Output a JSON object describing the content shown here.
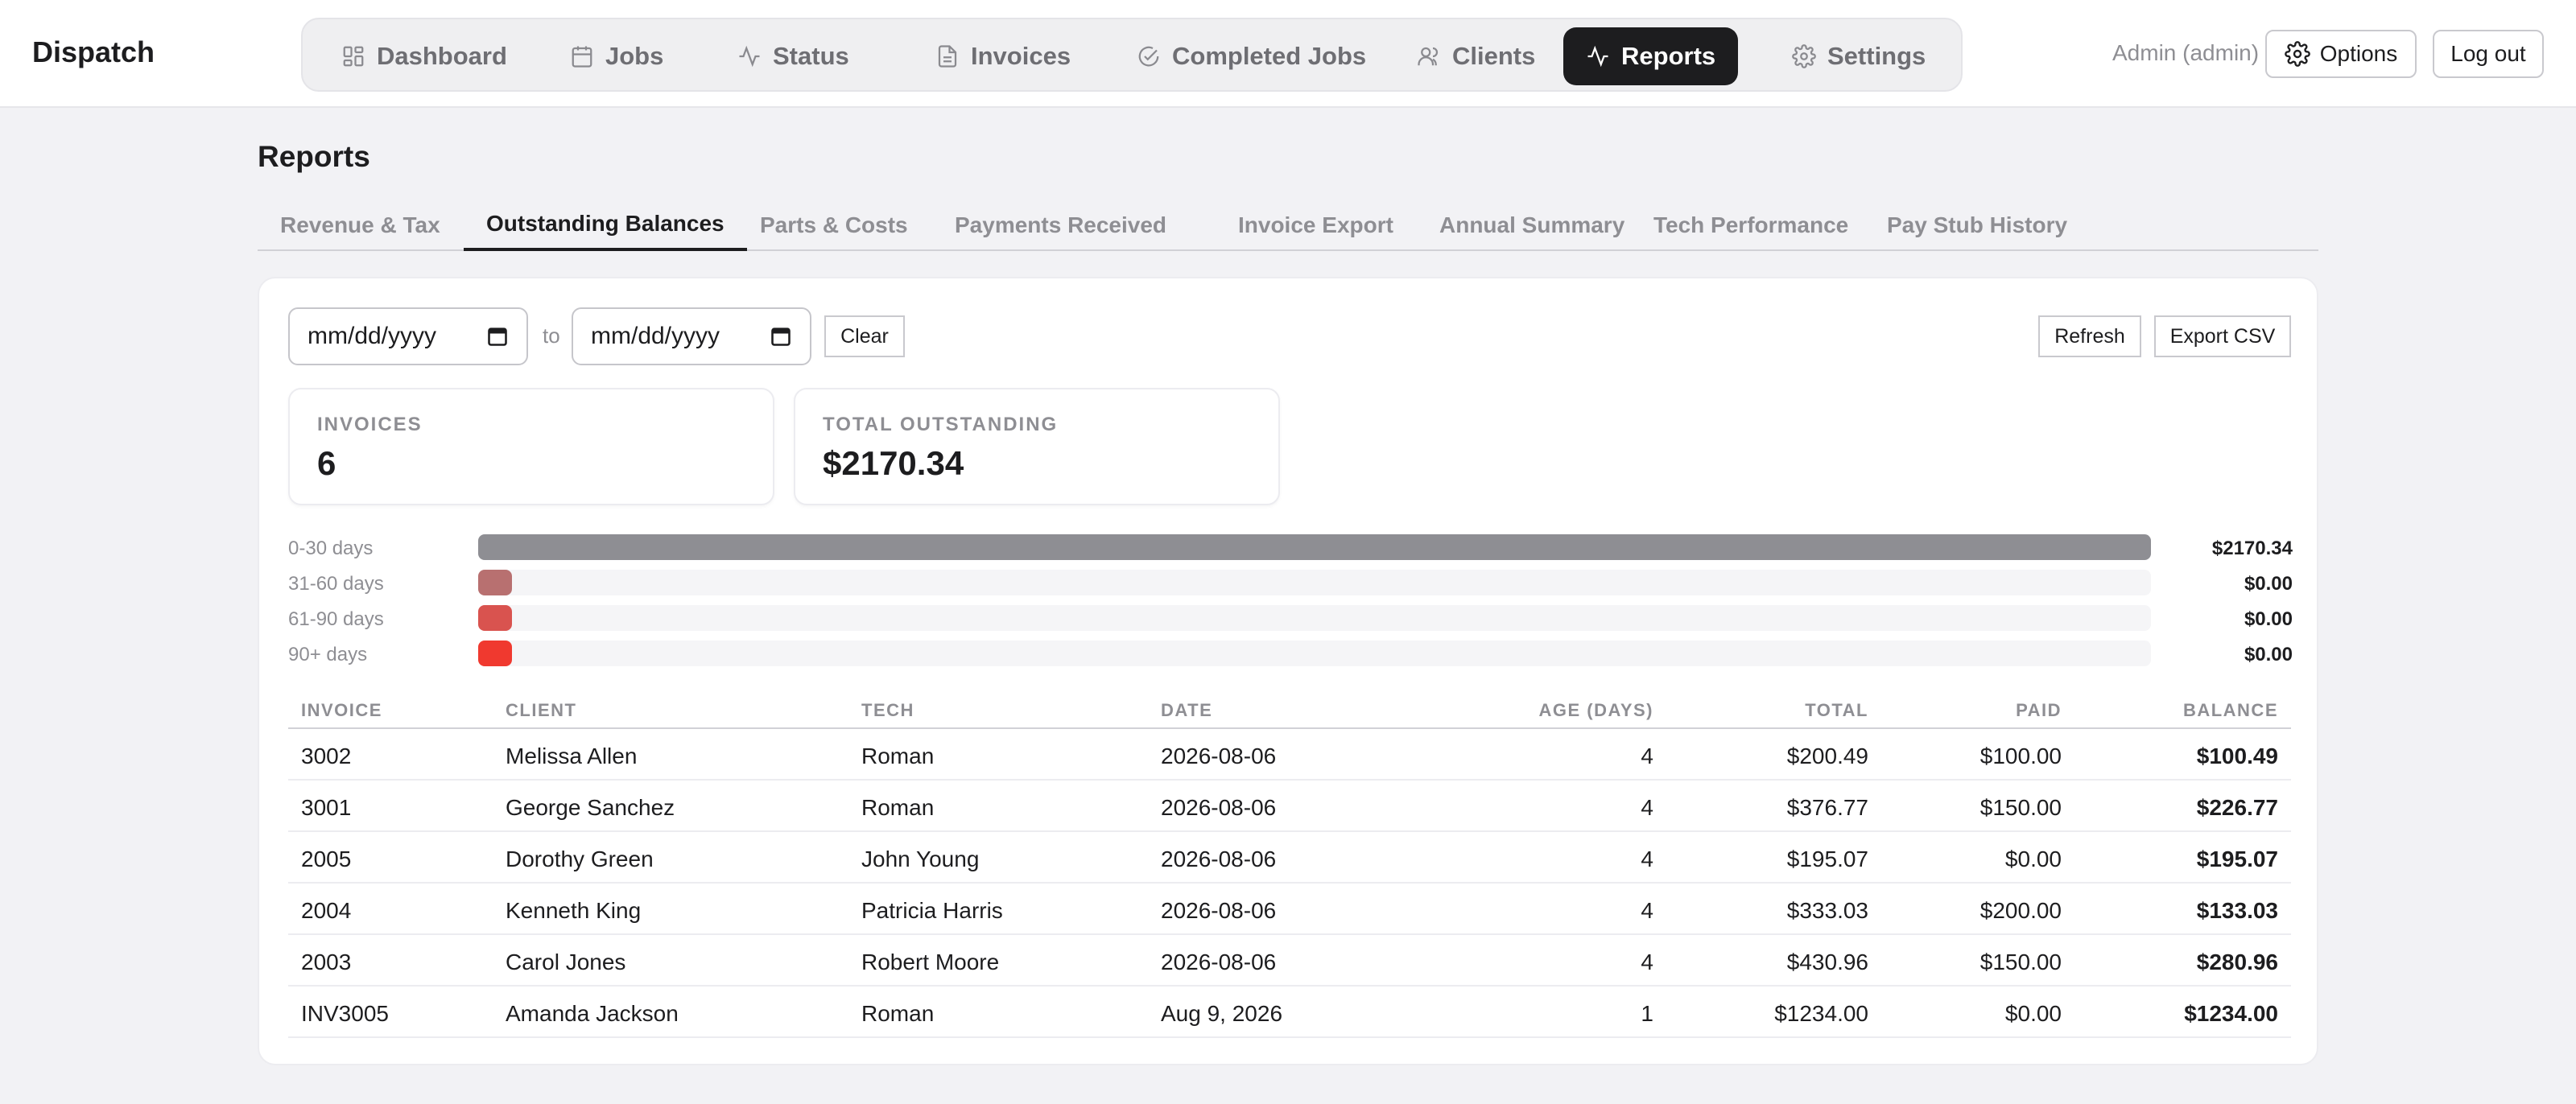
{
  "app": {
    "brand": "Dispatch"
  },
  "nav": {
    "items": [
      {
        "label": "Dashboard",
        "icon": "dashboard-icon"
      },
      {
        "label": "Jobs",
        "icon": "calendar-icon"
      },
      {
        "label": "Status",
        "icon": "activity-icon"
      },
      {
        "label": "Invoices",
        "icon": "document-icon"
      },
      {
        "label": "Completed Jobs",
        "icon": "check-circle-icon"
      },
      {
        "label": "Clients",
        "icon": "users-icon"
      },
      {
        "label": "Reports",
        "icon": "activity-icon"
      },
      {
        "label": "Settings",
        "icon": "gear-icon"
      }
    ],
    "active": "Reports"
  },
  "header": {
    "admin_label": "Admin (admin)",
    "options_label": "Options",
    "logout_label": "Log out"
  },
  "page": {
    "title": "Reports",
    "tabs": [
      "Revenue & Tax",
      "Outstanding Balances",
      "Parts & Costs",
      "Payments Received",
      "Invoice Export",
      "Annual Summary",
      "Tech Performance",
      "Pay Stub History"
    ],
    "active_tab": "Outstanding Balances"
  },
  "filters": {
    "from_placeholder": "mm/dd/yyyy",
    "to_label": "to",
    "to_placeholder": "mm/dd/yyyy",
    "clear_label": "Clear",
    "refresh_label": "Refresh",
    "export_label": "Export CSV"
  },
  "stats": {
    "invoices_label": "INVOICES",
    "invoices_value": "6",
    "outstanding_label": "TOTAL OUTSTANDING",
    "outstanding_value": "$2170.34"
  },
  "aging": [
    {
      "label": "0-30 days",
      "amount": "$2170.34",
      "fraction": 1.0,
      "color": "#8e8e93"
    },
    {
      "label": "31-60 days",
      "amount": "$0.00",
      "fraction": 0.0,
      "color": "#b87070"
    },
    {
      "label": "61-90 days",
      "amount": "$0.00",
      "fraction": 0.0,
      "color": "#d9534f"
    },
    {
      "label": "90+ days",
      "amount": "$0.00",
      "fraction": 0.0,
      "color": "#f0392f"
    }
  ],
  "table": {
    "columns": [
      "INVOICE",
      "CLIENT",
      "TECH",
      "DATE",
      "AGE (DAYS)",
      "TOTAL",
      "PAID",
      "BALANCE"
    ],
    "rows": [
      {
        "invoice": "3002",
        "client": "Melissa Allen",
        "tech": "Roman",
        "date": "2026-08-06",
        "age": "4",
        "total": "$200.49",
        "paid": "$100.00",
        "balance": "$100.49"
      },
      {
        "invoice": "3001",
        "client": "George Sanchez",
        "tech": "Roman",
        "date": "2026-08-06",
        "age": "4",
        "total": "$376.77",
        "paid": "$150.00",
        "balance": "$226.77"
      },
      {
        "invoice": "2005",
        "client": "Dorothy Green",
        "tech": "John Young",
        "date": "2026-08-06",
        "age": "4",
        "total": "$195.07",
        "paid": "$0.00",
        "balance": "$195.07"
      },
      {
        "invoice": "2004",
        "client": "Kenneth King",
        "tech": "Patricia Harris",
        "date": "2026-08-06",
        "age": "4",
        "total": "$333.03",
        "paid": "$200.00",
        "balance": "$133.03"
      },
      {
        "invoice": "2003",
        "client": "Carol Jones",
        "tech": "Robert Moore",
        "date": "2026-08-06",
        "age": "4",
        "total": "$430.96",
        "paid": "$150.00",
        "balance": "$280.96"
      },
      {
        "invoice": "INV3005",
        "client": "Amanda Jackson",
        "tech": "Roman",
        "date": "Aug 9, 2026",
        "age": "1",
        "total": "$1234.00",
        "paid": "$0.00",
        "balance": "$1234.00"
      }
    ]
  }
}
